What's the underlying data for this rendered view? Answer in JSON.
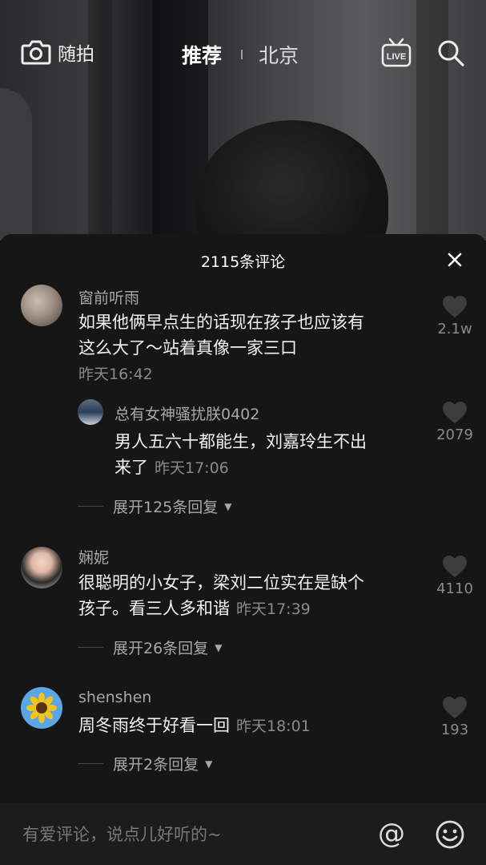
{
  "topbar": {
    "camera_label": "随拍",
    "tab_recommend": "推荐",
    "tab_city": "北京"
  },
  "sheet": {
    "title": "2115条评论"
  },
  "comments": [
    {
      "username": "窗前听雨",
      "text_line1": "如果他俩早点生的话现在孩子也应该有",
      "text_line2": "这么大了～站着真像一家三口",
      "time": "昨天16:42",
      "likes": "2.1w"
    },
    {
      "username": "总有女神骚扰朕0402",
      "text_line1": "男人五六十都能生，刘嘉玲生不出",
      "text_line2": "来了",
      "time": "昨天17:06",
      "likes": "2079",
      "expand": "展开125条回复"
    },
    {
      "username": "娴妮",
      "text_line1": "很聪明的小女子，梁刘二位实在是缺个",
      "text_line2": "孩子。看三人多和谐",
      "time": "昨天17:39",
      "likes": "4110",
      "expand": "展开26条回复"
    },
    {
      "username": "shenshen",
      "text_line1": "周冬雨终于好看一回",
      "time": "昨天18:01",
      "likes": "193",
      "expand": "展开2条回复"
    }
  ],
  "input": {
    "placeholder": "有爱评论，说点儿好听的~",
    "at_symbol": "@"
  },
  "icons": {
    "camera": "camera-icon",
    "live": "live-icon",
    "search": "search-icon",
    "close": "close-icon",
    "heart": "heart-icon",
    "emoji": "emoji-icon"
  }
}
